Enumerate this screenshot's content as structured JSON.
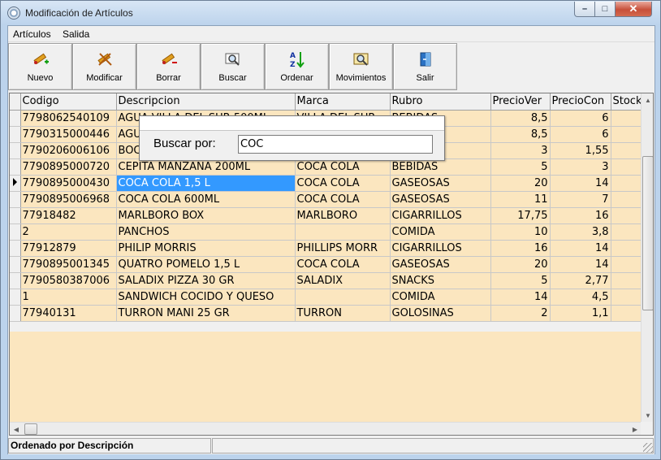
{
  "window": {
    "title": "Modificación de Artículos"
  },
  "menu": [
    {
      "label": "Artículos"
    },
    {
      "label": "Salida"
    }
  ],
  "toolbar": [
    {
      "label": "Nuevo",
      "icon": "new-item-icon"
    },
    {
      "label": "Modificar",
      "icon": "edit-item-icon"
    },
    {
      "label": "Borrar",
      "icon": "delete-item-icon"
    },
    {
      "label": "Buscar",
      "icon": "search-icon"
    },
    {
      "label": "Ordenar",
      "icon": "sort-az-icon"
    },
    {
      "label": "Movimientos",
      "icon": "movements-icon"
    },
    {
      "label": "Salir",
      "icon": "exit-door-icon"
    }
  ],
  "grid": {
    "columns": [
      "Codigo",
      "Descripcion",
      "Marca",
      "Rubro",
      "PrecioVer",
      "PrecioCon",
      "Stock"
    ],
    "rows": [
      {
        "codigo": "77980625401​09",
        "descripcion": "AGUA VILLA DEL SUR 500ML",
        "marca": "VILLA DEL SUR",
        "rubro": "BEBIDAS",
        "precio_venta": "8,5",
        "precio_compra": "6"
      },
      {
        "codigo": "7790315000446",
        "descripcion": "AGUA",
        "marca": "",
        "rubro": "",
        "precio_venta": "8,5",
        "precio_compra": "6"
      },
      {
        "codigo": "7790206006106",
        "descripcion": "BOC",
        "marca": "",
        "rubro": "AS",
        "precio_venta": "3",
        "precio_compra": "1,55"
      },
      {
        "codigo": "7790895000720",
        "descripcion": "CEPITA MANZANA 200ML",
        "marca": "COCA COLA",
        "rubro": "BEBIDAS",
        "precio_venta": "5",
        "precio_compra": "3"
      },
      {
        "codigo": "7790895000430",
        "descripcion": "COCA COLA 1,5 L",
        "marca": "COCA COLA",
        "rubro": "GASEOSAS",
        "precio_venta": "20",
        "precio_compra": "14",
        "selected": true
      },
      {
        "codigo": "7790895006968",
        "descripcion": "COCA COLA 600ML",
        "marca": "COCA COLA",
        "rubro": "GASEOSAS",
        "precio_venta": "11",
        "precio_compra": "7"
      },
      {
        "codigo": "77918482",
        "descripcion": "MARLBORO BOX",
        "marca": "MARLBORO",
        "rubro": "CIGARRILLOS",
        "precio_venta": "17,75",
        "precio_compra": "16"
      },
      {
        "codigo": "2",
        "descripcion": "PANCHOS",
        "marca": "",
        "rubro": "COMIDA",
        "precio_venta": "10",
        "precio_compra": "3,8"
      },
      {
        "codigo": "77912879",
        "descripcion": "PHILIP MORRIS",
        "marca": "PHILLIPS MORR",
        "rubro": "CIGARRILLOS",
        "precio_venta": "16",
        "precio_compra": "14"
      },
      {
        "codigo": "7790895001345",
        "descripcion": "QUATRO POMELO 1,5 L",
        "marca": "COCA COLA",
        "rubro": "GASEOSAS",
        "precio_venta": "20",
        "precio_compra": "14"
      },
      {
        "codigo": "7790580387006",
        "descripcion": "SALADIX  PIZZA 30 GR",
        "marca": "SALADIX",
        "rubro": "SNACKS",
        "precio_venta": "5",
        "precio_compra": "2,77"
      },
      {
        "codigo": "1",
        "descripcion": "SANDWICH COCIDO Y QUESO",
        "marca": "",
        "rubro": "COMIDA",
        "precio_venta": "14",
        "precio_compra": "4,5"
      },
      {
        "codigo": "77940131",
        "descripcion": "TURRON MANI 25 GR",
        "marca": "TURRON",
        "rubro": "GOLOSINAS",
        "precio_venta": "2",
        "precio_compra": "1,1"
      }
    ]
  },
  "search": {
    "label": "Buscar por:",
    "value": "COC"
  },
  "status": {
    "sort_text": "Ordenado por Descripción",
    "secondary": ""
  },
  "colors": {
    "grid_row": "#fbe6bf",
    "selection": "#3399ff",
    "frame": "#bcd3ec"
  }
}
